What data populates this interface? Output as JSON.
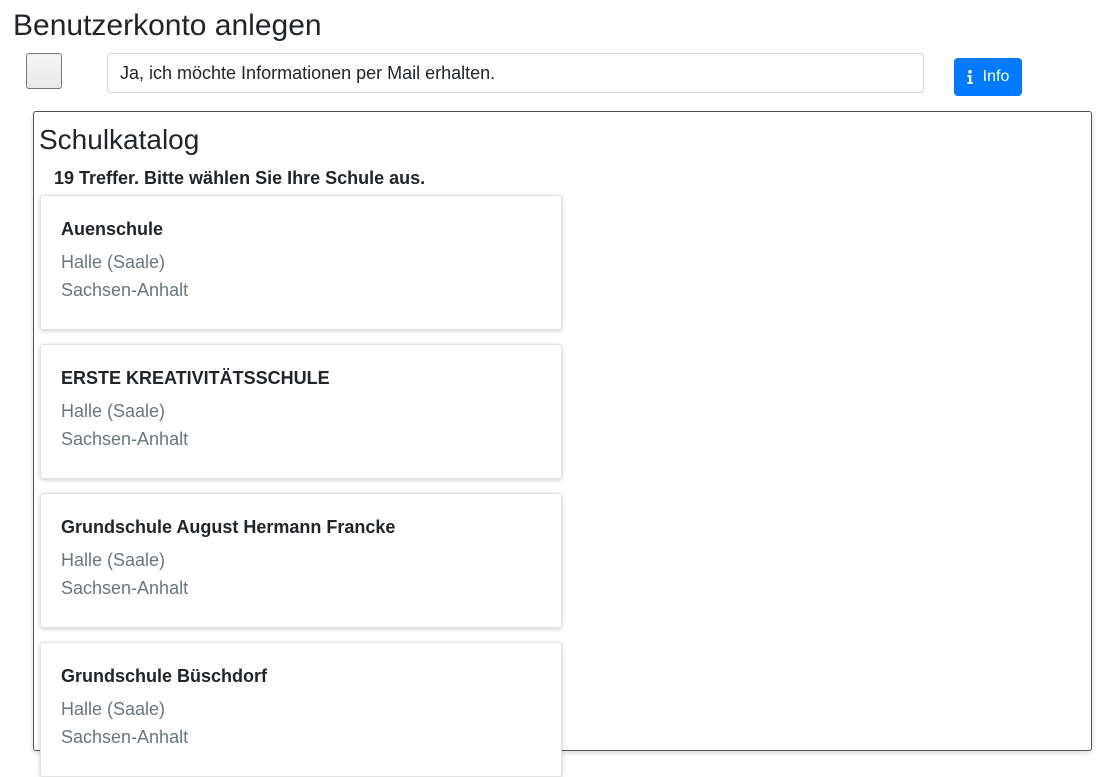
{
  "page": {
    "title": "Benutzerkonto anlegen"
  },
  "consent": {
    "checked": false,
    "label": "Ja, ich möchte Informationen per Mail erhalten."
  },
  "info_button": {
    "label": "Info",
    "icon": "info-icon"
  },
  "catalog": {
    "title": "Schulkatalog",
    "result_text": "19 Treffer. Bitte wählen Sie Ihre Schule aus.",
    "schools": [
      {
        "name": "Auenschule",
        "city": "Halle (Saale)",
        "state": "Sachsen-Anhalt"
      },
      {
        "name": "ERSTE KREATIVITÄTSSCHULE",
        "city": "Halle (Saale)",
        "state": "Sachsen-Anhalt"
      },
      {
        "name": "Grundschule August Hermann Francke",
        "city": "Halle (Saale)",
        "state": "Sachsen-Anhalt"
      },
      {
        "name": "Grundschule Büschdorf",
        "city": "Halle (Saale)",
        "state": "Sachsen-Anhalt"
      }
    ]
  },
  "colors": {
    "primary": "#007bff",
    "muted_text": "#6c757d"
  }
}
